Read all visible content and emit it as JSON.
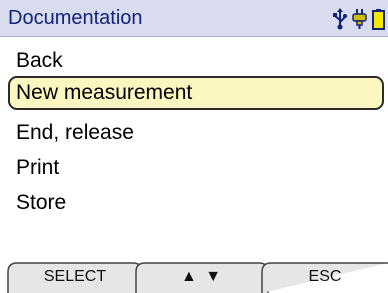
{
  "header": {
    "title": "Documentation",
    "icons": [
      "usb-icon",
      "plug-icon",
      "battery-icon"
    ]
  },
  "menu": {
    "selected_index": 1,
    "items": [
      {
        "label": "Back"
      },
      {
        "label": "New measurement"
      },
      {
        "label": "End, release"
      },
      {
        "label": "Print"
      },
      {
        "label": "Store"
      }
    ]
  },
  "softkeys": {
    "left": "SELECT",
    "middle": "▲ ▼",
    "right": "ESC"
  },
  "colors": {
    "header_bg": "#d8dcee",
    "header_text": "#12237a",
    "selection_bg": "#fcf7c1",
    "icon_accent": "#d1bd00"
  }
}
